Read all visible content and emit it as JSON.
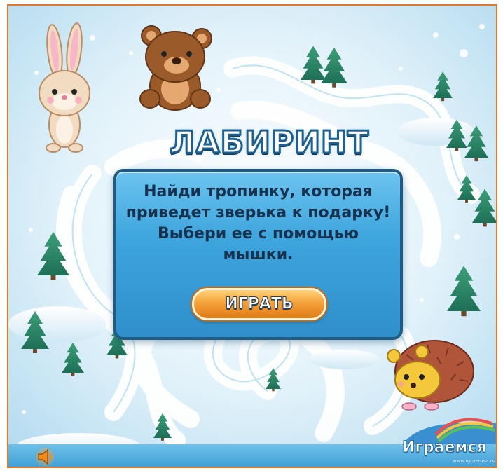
{
  "game": {
    "title": "ЛАБИРИНТ",
    "instructions": [
      "Найди тропинку, которая",
      "приведет зверька к подарку!",
      "Выбери ее с помощью",
      "мышки."
    ],
    "play_label": "ИГРАТЬ"
  },
  "brand": {
    "name": "Играемся",
    "url": "www.igraemsa.ru"
  },
  "characters": [
    "bunny",
    "bear",
    "hedgehog"
  ],
  "icons": {
    "sound": "speaker-icon"
  },
  "colors": {
    "frame_border": "#e07a2a",
    "panel": "#3ea5dd",
    "panel_border": "#1e5c86",
    "text": "#17324f",
    "button": "#f5a13a",
    "background": "#d4edf9"
  }
}
